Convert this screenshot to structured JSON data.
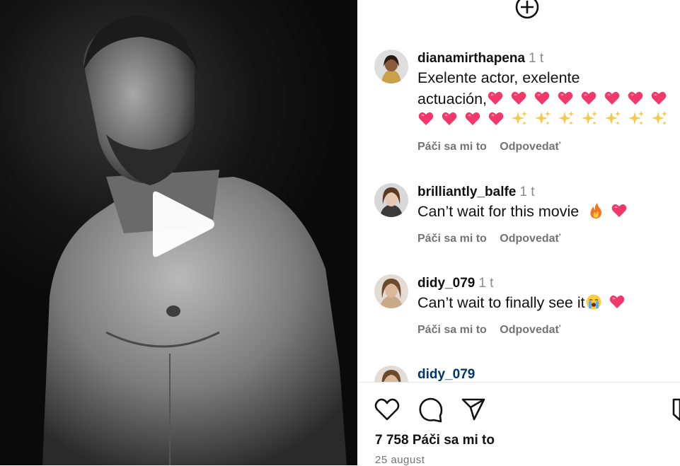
{
  "post": {
    "icons": {
      "play": "play-icon",
      "new_post": "plus-circle-icon",
      "like": "heart-outline-icon",
      "comment": "comment-bubble-icon",
      "share": "paper-plane-icon",
      "save": "bookmark-icon"
    },
    "likes_text": "7 758 Páči sa mi to",
    "date_text": "25 august"
  },
  "comments": [
    {
      "username": "dianamirthapena",
      "time": "1 t",
      "text_line1": "Exelente actor, exelente",
      "text_line2": "actuación,",
      "emoji_line2": [
        "heart",
        "heart",
        "heart",
        "heart",
        "heart",
        "heart",
        "heart",
        "heart"
      ],
      "emoji_line3": [
        "heart",
        "heart",
        "heart",
        "heart",
        "sparkles",
        "sparkles",
        "sparkles",
        "sparkles",
        "sparkles",
        "sparkles",
        "sparkles"
      ],
      "like_label": "Páči sa mi to",
      "reply_label": "Odpovedať"
    },
    {
      "username": "brilliantly_balfe",
      "time": "1 t",
      "text": "Can’t wait for this movie",
      "emoji": [
        "fire",
        "heart"
      ],
      "like_label": "Páči sa mi to",
      "reply_label": "Odpovedať"
    },
    {
      "username": "didy_079",
      "time": "1 t",
      "text": "Can’t wait to finally see it",
      "emoji": [
        "crying-face",
        "heart"
      ],
      "like_label": "Páči sa mi to",
      "reply_label": "Odpovedať"
    },
    {
      "username": "didy_079"
    }
  ],
  "colors": {
    "heart": "#f0386b",
    "sparkles": "#f7c948",
    "username_partial": "#00376b"
  }
}
